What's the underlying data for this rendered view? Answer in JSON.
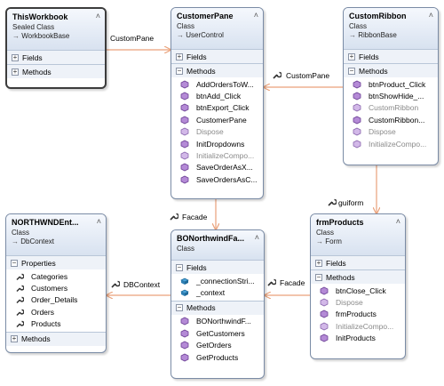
{
  "classes": {
    "thisworkbook": {
      "name": "ThisWorkbook",
      "kind": "Sealed Class",
      "base": "WorkbookBase",
      "sections": [
        "Fields",
        "Methods"
      ]
    },
    "customerpane": {
      "name": "CustomerPane",
      "kind": "Class",
      "base": "UserControl",
      "fields_label": "Fields",
      "methods_label": "Methods",
      "methods": [
        "AddOrdersToW...",
        "btnAdd_Click",
        "btnExport_Click",
        "CustomerPane",
        "Dispose",
        "InitDropdowns",
        "InitializeCompo...",
        "SaveOrderAsX...",
        "SaveOrdersAsC..."
      ]
    },
    "customribbon": {
      "name": "CustomRibbon",
      "kind": "Class",
      "base": "RibbonBase",
      "fields_label": "Fields",
      "methods_label": "Methods",
      "methods": [
        "btnProduct_Click",
        "btnShowHide_...",
        "CustomRibbon",
        "CustomRibbon...",
        "Dispose",
        "InitializeCompo..."
      ]
    },
    "northwnd": {
      "name": "NORTHWNDEnt...",
      "kind": "Class",
      "base": "DbContext",
      "properties_label": "Properties",
      "methods_label": "Methods",
      "properties": [
        "Categories",
        "Customers",
        "Order_Details",
        "Orders",
        "Products"
      ]
    },
    "bonorthwind": {
      "name": "BONorthwindFa...",
      "kind": "Class",
      "fields_label": "Fields",
      "methods_label": "Methods",
      "fields": [
        "_connectionStri...",
        "_context"
      ],
      "methods": [
        "BONorthwindF...",
        "GetCustomers",
        "GetOrders",
        "GetProducts"
      ]
    },
    "frmproducts": {
      "name": "frmProducts",
      "kind": "Class",
      "base": "Form",
      "fields_label": "Fields",
      "methods_label": "Methods",
      "methods": [
        "btnClose_Click",
        "Dispose",
        "frmProducts",
        "InitializeCompo...",
        "InitProducts"
      ]
    }
  },
  "associations": {
    "custompane_1": "CustomPane",
    "custompane_2": "CustomPane",
    "guiform": "guiform",
    "facade_1": "Facade",
    "facade_2": "Facade",
    "dbcontext": "DBContext"
  },
  "colors": {
    "border": "#7a8ba5",
    "connector": "#e9a17a",
    "header_top": "#f5f8fd",
    "header_bottom": "#d8e2f0"
  }
}
